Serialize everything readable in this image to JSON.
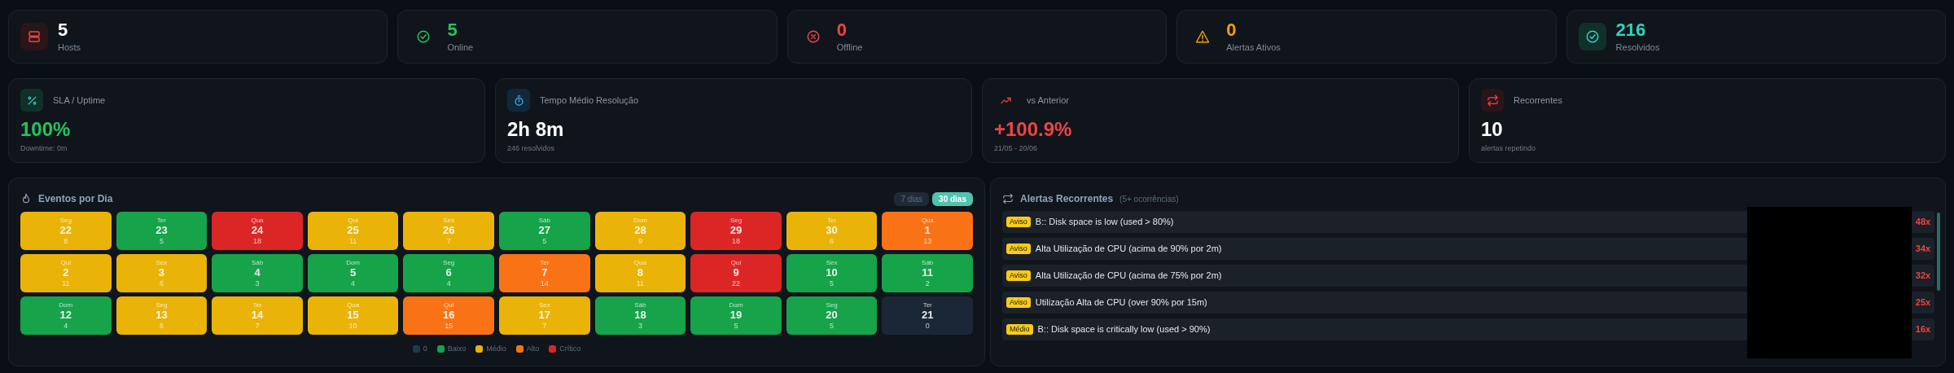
{
  "summary_cards": [
    {
      "kind": "hosts",
      "value": "5",
      "label": "Hosts"
    },
    {
      "kind": "online",
      "value": "5",
      "label": "Online"
    },
    {
      "kind": "offline",
      "value": "0",
      "label": "Offline"
    },
    {
      "kind": "alerts",
      "value": "0",
      "label": "Alertas Ativos"
    },
    {
      "kind": "resolved",
      "value": "216",
      "label": "Resolvidos"
    }
  ],
  "metric_cards": [
    {
      "kind": "sla",
      "title": "SLA / Uptime",
      "value": "100%",
      "sub": "Downtime: 0m"
    },
    {
      "kind": "time",
      "title": "Tempo Médio Resolução",
      "value": "2h 8m",
      "sub": "246 resolvidos"
    },
    {
      "kind": "trend",
      "title": "vs Anterior",
      "value": "+100.9%",
      "sub": "21/05 - 20/06"
    },
    {
      "kind": "recurring",
      "title": "Recorrentes",
      "value": "10",
      "sub": "alertas repetindo"
    }
  ],
  "events_panel": {
    "title": "Eventos por Dia",
    "ranges": [
      {
        "label": "7 dias",
        "selected": false
      },
      {
        "label": "30 dias",
        "selected": true
      }
    ],
    "days": [
      {
        "weekday": "Seg",
        "day": "22",
        "count": "8",
        "color": "#eab308"
      },
      {
        "weekday": "Ter",
        "day": "23",
        "count": "5",
        "color": "#16a34a"
      },
      {
        "weekday": "Qua",
        "day": "24",
        "count": "18",
        "color": "#dc2626"
      },
      {
        "weekday": "Qui",
        "day": "25",
        "count": "11",
        "color": "#eab308"
      },
      {
        "weekday": "Sex",
        "day": "26",
        "count": "7",
        "color": "#eab308"
      },
      {
        "weekday": "Sáb",
        "day": "27",
        "count": "5",
        "color": "#16a34a"
      },
      {
        "weekday": "Dom",
        "day": "28",
        "count": "9",
        "color": "#eab308"
      },
      {
        "weekday": "Seg",
        "day": "29",
        "count": "18",
        "color": "#dc2626"
      },
      {
        "weekday": "Ter",
        "day": "30",
        "count": "6",
        "color": "#eab308"
      },
      {
        "weekday": "Qua",
        "day": "1",
        "count": "13",
        "color": "#f97316"
      },
      {
        "weekday": "Qui",
        "day": "2",
        "count": "11",
        "color": "#eab308"
      },
      {
        "weekday": "Sex",
        "day": "3",
        "count": "6",
        "color": "#eab308"
      },
      {
        "weekday": "Sáb",
        "day": "4",
        "count": "3",
        "color": "#16a34a"
      },
      {
        "weekday": "Dom",
        "day": "5",
        "count": "4",
        "color": "#16a34a"
      },
      {
        "weekday": "Seg",
        "day": "6",
        "count": "4",
        "color": "#16a34a"
      },
      {
        "weekday": "Ter",
        "day": "7",
        "count": "14",
        "color": "#f97316"
      },
      {
        "weekday": "Qua",
        "day": "8",
        "count": "11",
        "color": "#eab308"
      },
      {
        "weekday": "Qui",
        "day": "9",
        "count": "22",
        "color": "#dc2626"
      },
      {
        "weekday": "Sex",
        "day": "10",
        "count": "5",
        "color": "#16a34a"
      },
      {
        "weekday": "Sáb",
        "day": "11",
        "count": "2",
        "color": "#16a34a"
      },
      {
        "weekday": "Dom",
        "day": "12",
        "count": "4",
        "color": "#16a34a"
      },
      {
        "weekday": "Seg",
        "day": "13",
        "count": "6",
        "color": "#eab308"
      },
      {
        "weekday": "Ter",
        "day": "14",
        "count": "7",
        "color": "#eab308"
      },
      {
        "weekday": "Qua",
        "day": "15",
        "count": "10",
        "color": "#eab308"
      },
      {
        "weekday": "Qui",
        "day": "16",
        "count": "15",
        "color": "#f97316"
      },
      {
        "weekday": "Sex",
        "day": "17",
        "count": "7",
        "color": "#eab308"
      },
      {
        "weekday": "Sáb",
        "day": "18",
        "count": "3",
        "color": "#16a34a"
      },
      {
        "weekday": "Dom",
        "day": "19",
        "count": "5",
        "color": "#16a34a"
      },
      {
        "weekday": "Seg",
        "day": "20",
        "count": "5",
        "color": "#16a34a"
      },
      {
        "weekday": "Ter",
        "day": "21",
        "count": "0",
        "color": "#1b2736"
      }
    ],
    "legend": [
      {
        "label": "0",
        "color": "#1e3a4f"
      },
      {
        "label": "Baixo",
        "color": "#16a34a"
      },
      {
        "label": "Médio",
        "color": "#eab308"
      },
      {
        "label": "Alto",
        "color": "#f97316"
      },
      {
        "label": "Crítico",
        "color": "#dc2626"
      }
    ]
  },
  "alerts_panel": {
    "title": "Alertas Recorrentes",
    "note": "(5+ ocorrências)",
    "alerts": [
      {
        "badge": "Aviso",
        "text": "B:: Disk space is low (used > 80%)",
        "count": "48x"
      },
      {
        "badge": "Aviso",
        "text": "Alta Utilização de CPU (acima de 90% por 2m)",
        "count": "34x"
      },
      {
        "badge": "Aviso",
        "text": "Alta Utilização de CPU (acima de 75% por 2m)",
        "count": "32x"
      },
      {
        "badge": "Aviso",
        "text": "Utilização Alta de CPU (over 90% por 15m)",
        "count": "25x"
      },
      {
        "badge": "Médio",
        "text": "B:: Disk space is critically low (used > 90%)",
        "count": "16x"
      }
    ]
  }
}
